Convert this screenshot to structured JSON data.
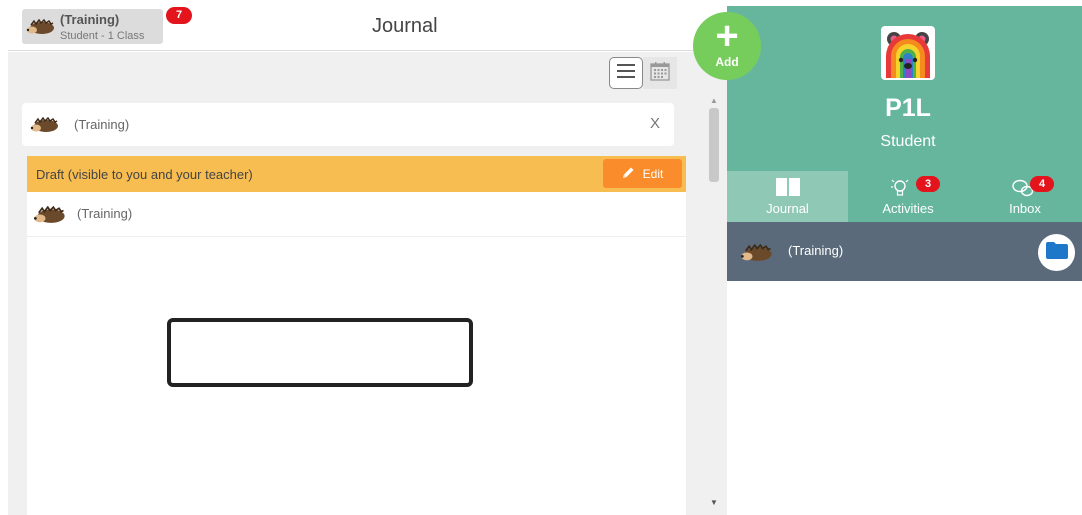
{
  "header": {
    "class_chip": {
      "name": "(Training)",
      "subtitle": "Student - 1 Class",
      "badge_count": "7"
    },
    "title": "Journal"
  },
  "add_button": {
    "label": "Add"
  },
  "view_toggle": {
    "list": "list-icon",
    "calendar": "calendar-icon"
  },
  "filter": {
    "label": "(Training)",
    "close": "X"
  },
  "entry": {
    "draft_text": "Draft (visible to you and your teacher)",
    "edit_label": "Edit",
    "author": "(Training)"
  },
  "profile": {
    "name": "P1L",
    "role": "Student"
  },
  "tabs": [
    {
      "label": "Journal",
      "icon": "book-icon",
      "badge": ""
    },
    {
      "label": "Activities",
      "icon": "lightbulb-icon",
      "badge": "3"
    },
    {
      "label": "Inbox",
      "icon": "chat-bubbles-icon",
      "badge": "4"
    }
  ],
  "class_row": {
    "label": "(Training)",
    "icon": "folder-icon"
  },
  "colors": {
    "accent_green": "#66b69e",
    "add_green": "#76cd5c",
    "draft_yellow": "#f7bd51",
    "edit_orange": "#fb8c2b",
    "badge_red": "#e3141b",
    "class_row_slate": "#5a6a7a"
  }
}
